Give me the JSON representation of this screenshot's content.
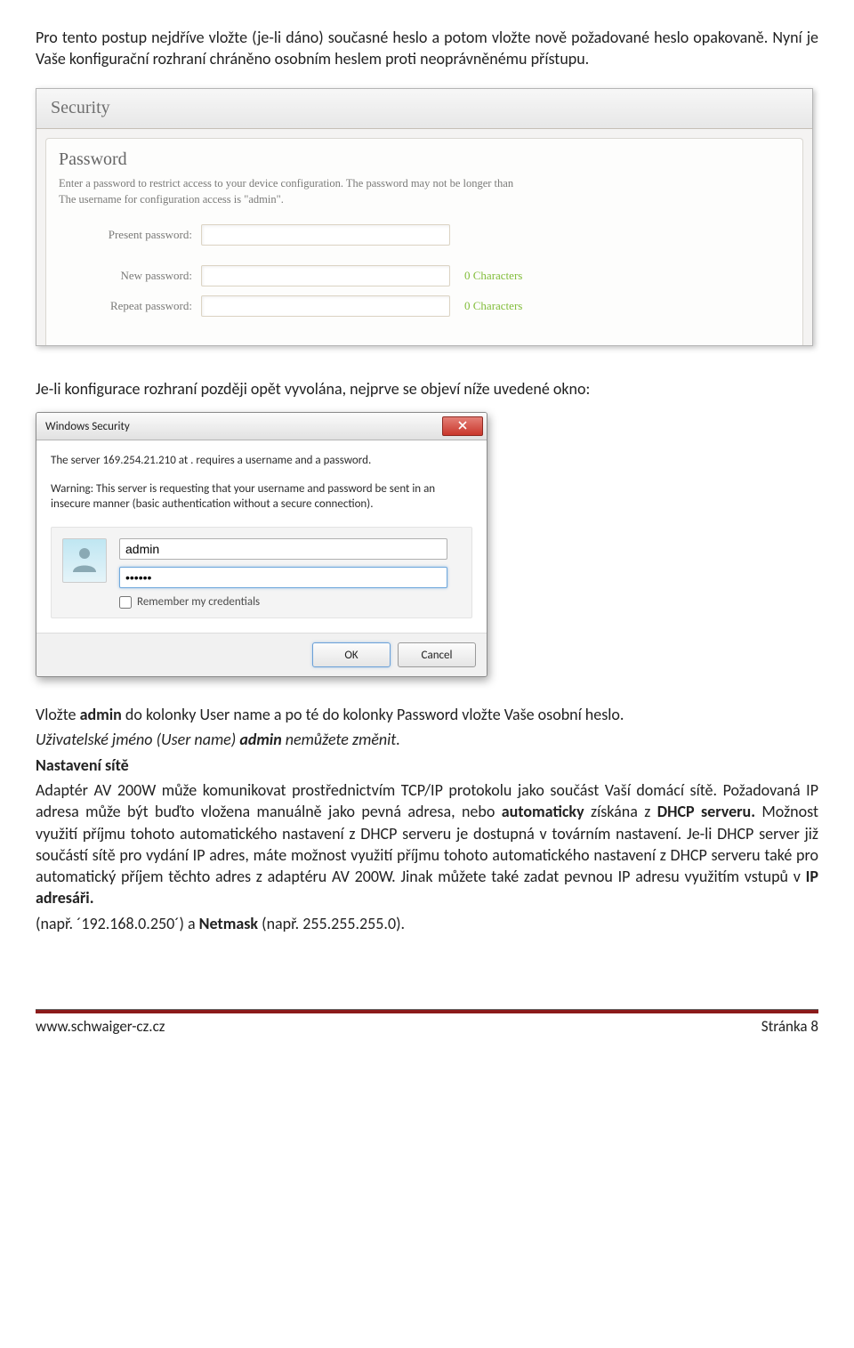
{
  "intro": "Pro tento postup nejdříve vložte (je-li dáno) současné heslo a potom vložte nově požadované heslo opakovaně. Nyní je Vaše konfigurační rozhraní chráněno osobním heslem proti neoprávněnému přístupu.",
  "security": {
    "tab_title": "Security",
    "password_title": "Password",
    "hint_line1": "Enter a password to restrict access to your device configuration. The password may not be longer than",
    "hint_line2": "The username for configuration access is \"admin\".",
    "present_label": "Present password:",
    "new_label": "New password:",
    "repeat_label": "Repeat password:",
    "new_count": "0 Characters",
    "repeat_count": "0 Characters"
  },
  "mid_text": "Je-li konfigurace rozhraní později opět vyvolána, nejprve se objeví níže uvedené okno:",
  "winsec": {
    "title": "Windows Security",
    "line1": "The server 169.254.21.210 at . requires a username and a password.",
    "line2": "Warning: This server is requesting that your username and password be sent in an insecure manner (basic authentication without a secure connection).",
    "user_value": "admin",
    "pass_value": "••••••",
    "remember_label": "Remember my credentials",
    "ok": "OK",
    "cancel": "Cancel"
  },
  "after": {
    "p1a": "Vložte ",
    "p1b": "admin",
    "p1c": " do kolonky User name a po té do kolonky Password vložte Vaše osobní heslo.",
    "p2a": "Uživatelské jméno (User name) ",
    "p2b": "admin",
    "p2c": " nemůžete změnit.",
    "heading": "Nastavení sítě",
    "body1": "Adaptér AV 200W může komunikovat prostřednictvím TCP/IP protokolu jako součást Vaší domácí sítě. Požadovaná IP adresa může být buďto vložena manuálně jako pevná adresa, nebo ",
    "body1b": "automaticky",
    "body1c": " získána z ",
    "body1d": "DHCP serveru.",
    "body1e": " Možnost využití příjmu tohoto automatického nastavení z DHCP serveru je dostupná v továrním nastavení. Je-li DHCP server již součástí sítě pro vydání IP adres, máte možnost využití příjmu tohoto automatického nastavení z DHCP serveru také pro automatický příjem těchto adres z adaptéru AV 200W. Jinak můžete také zadat pevnou IP adresu využitím vstupů v ",
    "body1f": "IP adresáři.",
    "body2a": "(např. ´192.168.0.250´) a ",
    "body2b": "Netmask",
    "body2c": " (např. 255.255.255.0)."
  },
  "footer": {
    "url": "www.schwaiger-cz.cz",
    "page": "Stránka 8"
  }
}
